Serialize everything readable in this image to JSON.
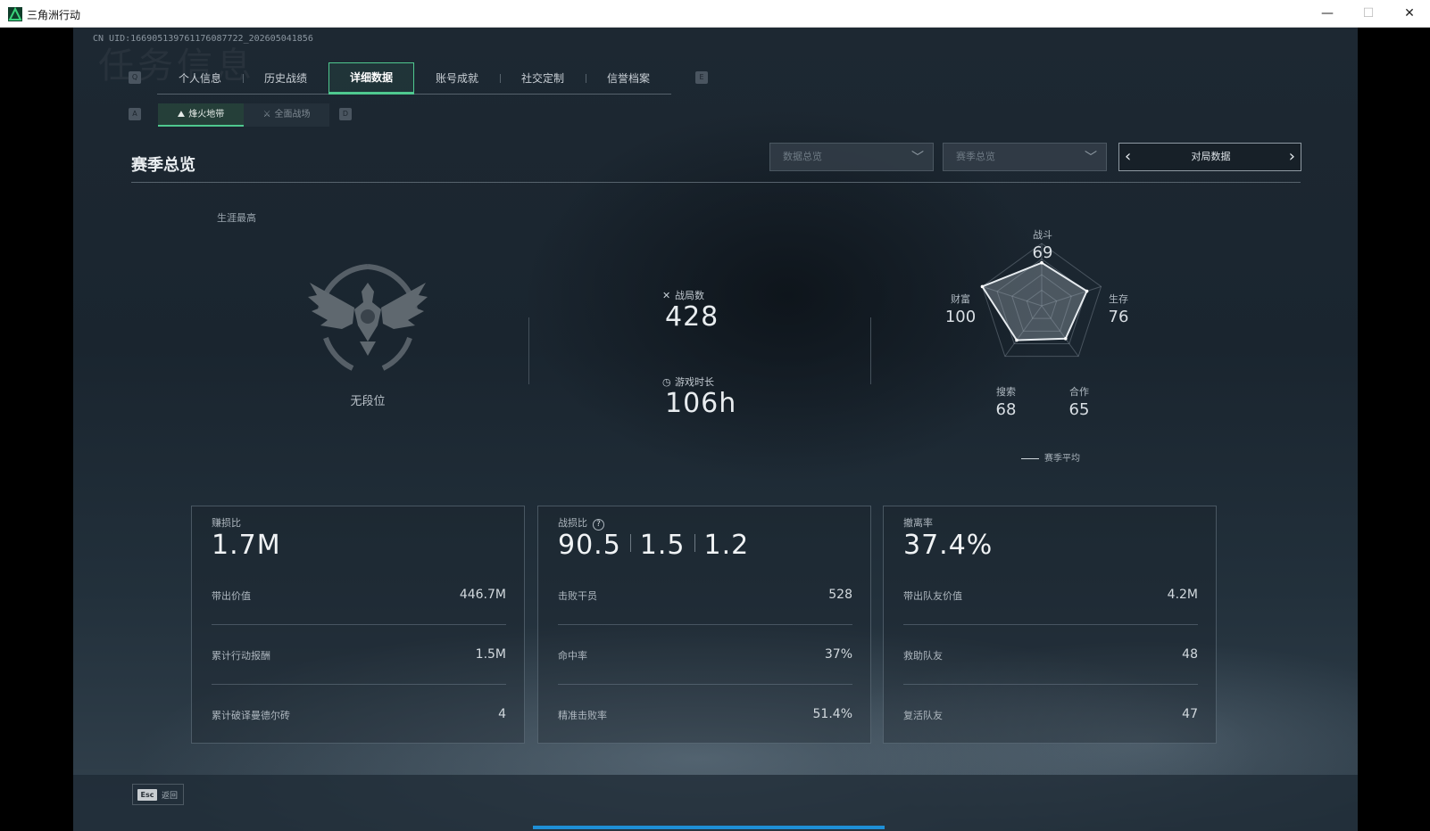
{
  "window": {
    "title": "三角洲行动",
    "minimize": "—",
    "maximize": "☐",
    "close": "✕"
  },
  "uid": "CN UID:1669051397611760877​22_202605041856",
  "ghost_title": "任务信息",
  "tabs": {
    "left_key": "Q",
    "right_key": "E",
    "items": [
      "个人信息",
      "历史战绩",
      "详细数据",
      "账号成就",
      "社交定制",
      "信誉档案"
    ],
    "active_index": 2
  },
  "subtabs": {
    "left_key": "A",
    "right_key": "D",
    "items": [
      {
        "label": "烽火地带",
        "icon": "firezone-icon"
      },
      {
        "label": "全面战场",
        "icon": "battlefield-icon"
      }
    ],
    "active_index": 0
  },
  "section": {
    "title": "赛季总览",
    "dropdown1": "数据总览",
    "dropdown2": "赛季总览",
    "pager_label": "对局数据"
  },
  "overview": {
    "career_label": "生涯最高",
    "rank": "无段位",
    "matches_label": "战局数",
    "matches": "428",
    "playtime_label": "游戏时长",
    "playtime": "106h"
  },
  "radar": {
    "axes": [
      {
        "label": "战斗",
        "value": "69"
      },
      {
        "label": "生存",
        "value": "76"
      },
      {
        "label": "合作",
        "value": "65"
      },
      {
        "label": "搜索",
        "value": "68"
      },
      {
        "label": "财富",
        "value": "100"
      }
    ],
    "values": [
      69,
      76,
      65,
      68,
      100
    ],
    "max": 100,
    "legend": "赛季平均"
  },
  "cards": [
    {
      "label": "赚损比",
      "big": "1.7M",
      "rows": [
        {
          "label": "带出价值",
          "value": "446.7M"
        },
        {
          "label": "累计行动报酬",
          "value": "1.5M"
        },
        {
          "label": "累计破译曼德尔砖",
          "value": "4"
        }
      ]
    },
    {
      "label": "战损比",
      "big_parts": [
        "90.5",
        "1.5",
        "1.2"
      ],
      "help": "?",
      "rows": [
        {
          "label": "击败干员",
          "value": "528"
        },
        {
          "label": "命中率",
          "value": "37%"
        },
        {
          "label": "精准击败率",
          "value": "51.4%"
        }
      ]
    },
    {
      "label": "撤离率",
      "big": "37.4%",
      "rows": [
        {
          "label": "带出队友价值",
          "value": "4.2M"
        },
        {
          "label": "救助队友",
          "value": "48"
        },
        {
          "label": "复活队友",
          "value": "47"
        }
      ]
    }
  ],
  "footer": {
    "esc_key": "Esc",
    "back_label": "返回"
  }
}
